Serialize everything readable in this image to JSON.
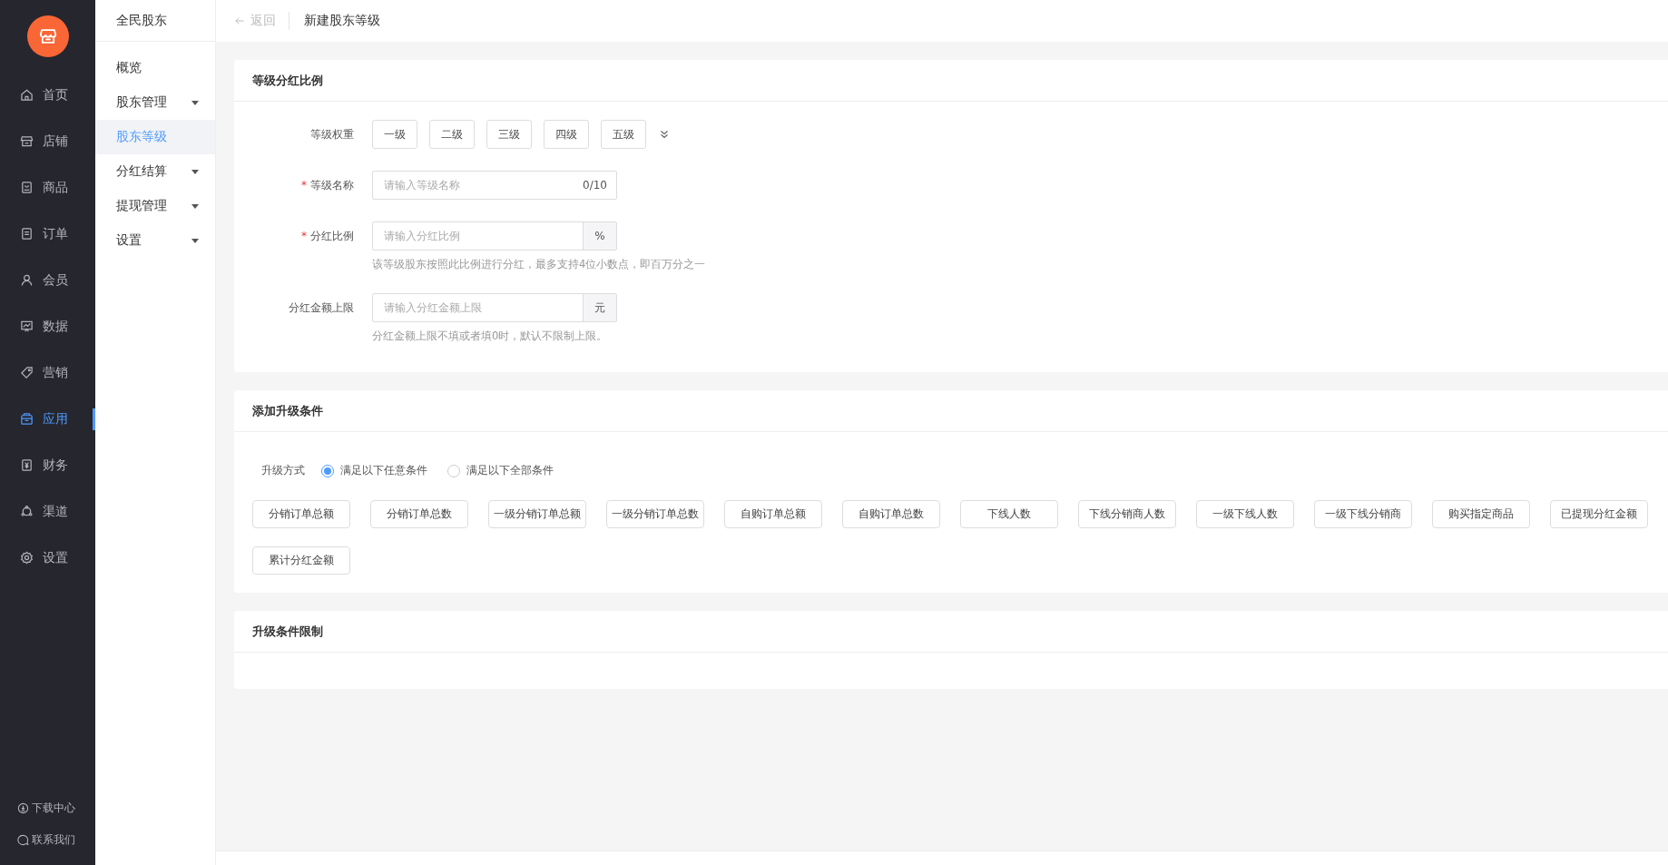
{
  "main_nav": [
    {
      "label": "首页",
      "selected": false
    },
    {
      "label": "店铺",
      "selected": false
    },
    {
      "label": "商品",
      "selected": false
    },
    {
      "label": "订单",
      "selected": false
    },
    {
      "label": "会员",
      "selected": false
    },
    {
      "label": "数据",
      "selected": false
    },
    {
      "label": "营销",
      "selected": false
    },
    {
      "label": "应用",
      "selected": true
    },
    {
      "label": "财务",
      "selected": false
    },
    {
      "label": "渠道",
      "selected": false
    },
    {
      "label": "设置",
      "selected": false
    }
  ],
  "main_nav_footer": [
    {
      "label": "下载中心"
    },
    {
      "label": "联系我们"
    }
  ],
  "sub_nav": {
    "title": "全民股东",
    "items": [
      {
        "label": "概览",
        "selected": false,
        "expandable": false
      },
      {
        "label": "股东管理",
        "selected": false,
        "expandable": true
      },
      {
        "label": "股东等级",
        "selected": true,
        "expandable": false
      },
      {
        "label": "分红结算",
        "selected": false,
        "expandable": true
      },
      {
        "label": "提现管理",
        "selected": false,
        "expandable": true
      },
      {
        "label": "设置",
        "selected": false,
        "expandable": true
      }
    ]
  },
  "header": {
    "back": "返回",
    "title": "新建股东等级"
  },
  "sections": [
    {
      "title": "等级分红比例",
      "fields": [
        {
          "kind": "levels",
          "label": "等级权重",
          "options": [
            "一级",
            "二级",
            "三级",
            "四级",
            "五级"
          ]
        },
        {
          "kind": "counter",
          "label": "等级名称",
          "required_mark": "*",
          "placeholder": "请输入等级名称",
          "counter": "0/10"
        },
        {
          "kind": "suffix",
          "label": "分红比例",
          "required_mark": "*",
          "placeholder": "请输入分红比例",
          "suffix": "%",
          "hint": "该等级股东按照此比例进行分红，最多支持4位小数点，即百万分之一"
        },
        {
          "kind": "suffix",
          "label": "分红金额上限",
          "placeholder": "请输入分红金额上限",
          "suffix": "元",
          "hint": "分红金额上限不填或者填0时，默认不限制上限。"
        }
      ]
    },
    {
      "title": "添加升级条件",
      "fields": [
        {
          "kind": "radio",
          "label": "升级方式",
          "options": [
            {
              "label": "满足以下任意条件",
              "selected": true
            },
            {
              "label": "满足以下全部条件",
              "selected": false
            }
          ]
        },
        {
          "kind": "chips",
          "options": [
            "分销订单总额",
            "分销订单总数",
            "一级分销订单总额",
            "一级分销订单总数",
            "自购订单总额",
            "自购订单总数",
            "下线人数",
            "下线分销商人数",
            "一级下线人数",
            "一级下线分销商",
            "购买指定商品",
            "已提现分红金额",
            "累计分红金额"
          ]
        }
      ]
    },
    {
      "title": "升级条件限制"
    }
  ]
}
